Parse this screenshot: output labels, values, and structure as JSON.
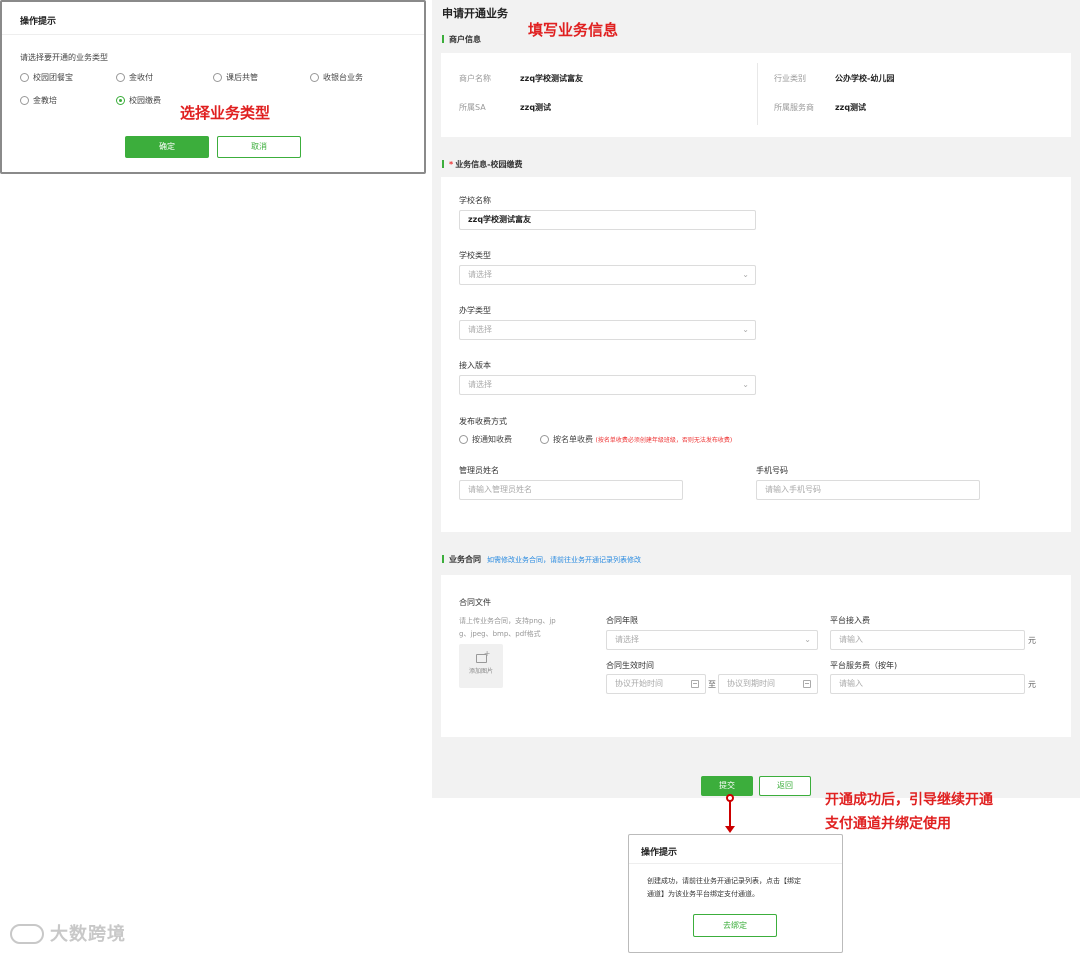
{
  "main": {
    "page_title": "申请开通业务",
    "merchant": {
      "section_title": "商户信息",
      "name_label": "商户名称",
      "name_value": "zzq学校测试富友",
      "sa_label": "所属SA",
      "sa_value": "zzq测试",
      "industry_label": "行业类别",
      "industry_value": "公办学校-幼儿园",
      "provider_label": "所属服务商",
      "provider_value": "zzq测试"
    },
    "business": {
      "section_title": "业务信息-校园缴费",
      "required_mark": "*",
      "school_name_label": "学校名称",
      "school_name_value": "zzq学校测试富友",
      "school_type_label": "学校类型",
      "school_type_placeholder": "请选择",
      "run_type_label": "办学类型",
      "run_type_placeholder": "请选择",
      "access_version_label": "接入版本",
      "access_version_placeholder": "请选择",
      "charge_method_label": "发布收费方式",
      "charge_options": [
        "按通知收费",
        "按名单收费"
      ],
      "charge_note": "(按名单收费必须创建年级班级，否则无法发布收费)",
      "admin_name_label": "管理员姓名",
      "admin_name_placeholder": "请输入管理员姓名",
      "phone_label": "手机号码",
      "phone_placeholder": "请输入手机号码"
    },
    "contract": {
      "section_title": "业务合同",
      "section_note": "如需修改业务合同，请前往业务开通记录列表修改",
      "file_label": "合同文件",
      "file_hint_1": "请上传业务合同，支持png、jp",
      "file_hint_2": "g、jpeg、bmp、pdf格式",
      "upload_label": "添加图片",
      "term_label": "合同年限",
      "term_placeholder": "请选择",
      "effective_label": "合同生效时间",
      "start_placeholder": "协议开始时间",
      "to_text": "至",
      "end_placeholder": "协议到期时间",
      "access_fee_label": "平台接入费",
      "access_fee_placeholder": "请输入",
      "service_fee_label": "平台服务费（按年)",
      "service_fee_placeholder": "请输入",
      "unit": "元"
    },
    "submit_label": "提交",
    "back_label": "返回"
  },
  "dialog_type": {
    "title": "操作提示",
    "prompt": "请选择要开通的业务类型",
    "options": [
      "校园团餐宝",
      "金收付",
      "课后共管",
      "收银台业务",
      "金教培",
      "校园缴费"
    ],
    "selected": "校园缴费",
    "confirm_label": "确定",
    "cancel_label": "取消"
  },
  "dialog_success": {
    "title": "操作提示",
    "message_1": "创建成功，请前往业务开通记录列表，点击【绑定",
    "message_2": "通道】为该业务平台绑定支付通道。",
    "bind_label": "去绑定"
  },
  "annotations": {
    "fill_info": "填写业务信息",
    "select_type": "选择业务类型",
    "guide_line_1": "开通成功后，引导继续开通",
    "guide_line_2": "支付通道并绑定使用"
  },
  "watermark": "大数跨境",
  "colors": {
    "primary": "#3cae3c",
    "annotation": "#e02020",
    "note_blue": "#2a8be0"
  }
}
